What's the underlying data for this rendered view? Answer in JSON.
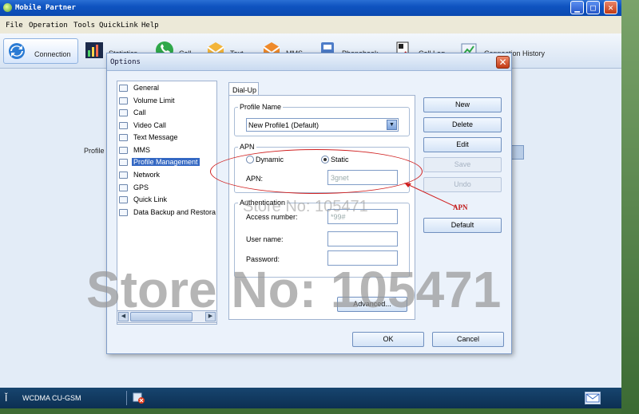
{
  "window": {
    "title": "Mobile Partner",
    "controls": [
      "minimize",
      "maximize",
      "close"
    ]
  },
  "menu": [
    "File",
    "Operation",
    "Tools",
    "QuickLink",
    "Help"
  ],
  "toolbar": [
    {
      "label": "Connection",
      "icon": "connection-icon"
    },
    {
      "label": "Statistics",
      "icon": "statistics-icon"
    },
    {
      "label": "Call",
      "icon": "call-icon"
    },
    {
      "label": "Text",
      "icon": "text-icon"
    },
    {
      "label": "MMS",
      "icon": "mms-icon"
    },
    {
      "label": "Phonebook",
      "icon": "phonebook-icon"
    },
    {
      "label": "Call Log",
      "icon": "call-log-icon"
    },
    {
      "label": "Connection History",
      "icon": "connection-history-icon"
    }
  ],
  "background": {
    "profile_label": "Profile"
  },
  "status": {
    "network": "WCDMA  CU-GSM"
  },
  "dialog": {
    "title": "Options",
    "tree": [
      "General",
      "Volume Limit",
      "Call",
      "Video Call",
      "Text Message",
      "MMS",
      "Profile Management",
      "Network",
      "GPS",
      "Quick Link",
      "Data Backup and Restora"
    ],
    "selected_item": "Profile Management",
    "tab": "Dial-Up",
    "profile_name": {
      "group": "Profile Name",
      "value": "New Profile1 (Default)"
    },
    "apn": {
      "group": "APN",
      "dynamic_label": "Dynamic",
      "static_label": "Static",
      "selected": "Static",
      "apn_label": "APN:",
      "apn_value": "3gnet"
    },
    "auth": {
      "group": "Authentication",
      "access_label": "Access number:",
      "access_value": "*99#",
      "user_label": "User name:",
      "user_value": "",
      "password_label": "Password:",
      "password_value": ""
    },
    "advanced_label": "Advanced...",
    "buttons": {
      "new": "New",
      "delete": "Delete",
      "edit": "Edit",
      "save": "Save",
      "undo": "Undo",
      "default": "Default"
    },
    "ok": "OK",
    "cancel": "Cancel"
  },
  "annotation": {
    "note": "APN",
    "color": "#d02020"
  },
  "watermark": {
    "big": "Store No: 105471",
    "small": "Store No: 105471"
  }
}
